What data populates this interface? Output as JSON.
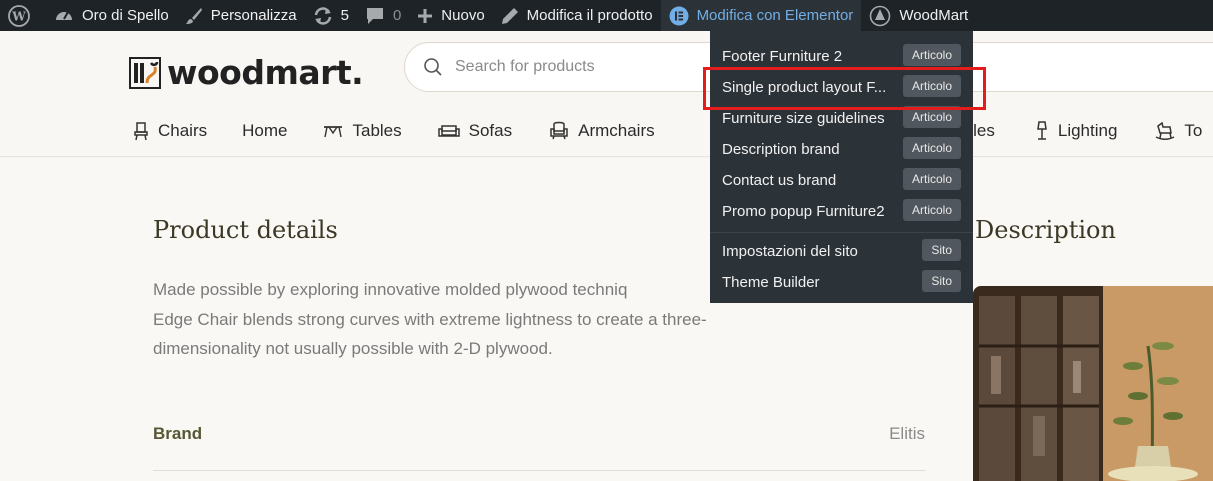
{
  "adminbar": {
    "site_name": "Oro di Spello",
    "customize": "Personalizza",
    "updates_count": "5",
    "comments_count": "0",
    "new": "Nuovo",
    "edit_product": "Modifica il prodotto",
    "elementor": "Modifica con Elementor",
    "woodmart": "WoodMart"
  },
  "header": {
    "logo_text": "woodmart.",
    "search_placeholder": "Search for products",
    "nav": [
      "Chairs",
      "Home",
      "Tables",
      "Sofas",
      "Armchairs",
      "tiles",
      "Lighting",
      "To"
    ]
  },
  "content": {
    "product_details_title": "Product details",
    "description_lines": [
      "Made possible by exploring innovative molded plywood techniq",
      "Edge Chair blends strong curves with extreme lightness to create a three-",
      "dimensionality not usually possible with 2-D plywood."
    ],
    "brand_label": "Brand",
    "brand_value": "Elitis",
    "description_title": "Description"
  },
  "dropdown": {
    "items": [
      {
        "label": "Footer Furniture 2",
        "badge": "Articolo"
      },
      {
        "label": "Single product layout F...",
        "badge": "Articolo"
      },
      {
        "label": "Furniture size guidelines",
        "badge": "Articolo"
      },
      {
        "label": "Description brand",
        "badge": "Articolo"
      },
      {
        "label": "Contact us brand",
        "badge": "Articolo"
      },
      {
        "label": "Promo popup Furniture2",
        "badge": "Articolo"
      }
    ],
    "site_items": [
      {
        "label": "Impostazioni del sito",
        "badge": "Sito"
      },
      {
        "label": "Theme Builder",
        "badge": "Sito"
      }
    ]
  },
  "colors": {
    "adminbar_bg": "#1d2327",
    "dropdown_bg": "#2c3338",
    "elementor_link": "#72aee6",
    "highlight": "#e61b1b",
    "heading": "#3c3826"
  }
}
